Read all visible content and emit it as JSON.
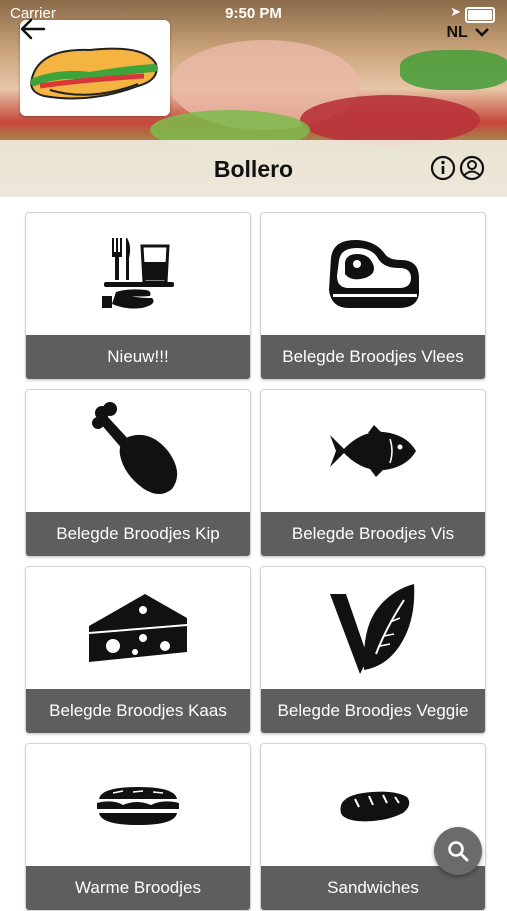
{
  "status_bar": {
    "carrier": "Carrier",
    "time": "9:50 PM"
  },
  "header": {
    "language": "NL",
    "title": "Bollero",
    "logo_icon": "sandwich-logo-icon",
    "back_icon": "arrow-left-icon",
    "info_icon": "info-icon",
    "account_icon": "user-circle-icon"
  },
  "categories": [
    {
      "label": "Nieuw!!!",
      "icon": "tray-cutlery-icon"
    },
    {
      "label": "Belegde Broodjes Vlees",
      "icon": "steak-icon"
    },
    {
      "label": "Belegde Broodjes Kip",
      "icon": "chicken-leg-icon"
    },
    {
      "label": "Belegde Broodjes Vis",
      "icon": "fish-icon"
    },
    {
      "label": "Belegde Broodjes Kaas",
      "icon": "cheese-icon"
    },
    {
      "label": "Belegde Broodjes Veggie",
      "icon": "veggie-leaf-icon"
    },
    {
      "label": "Warme Broodjes",
      "icon": "hot-sandwich-icon"
    },
    {
      "label": "Sandwiches",
      "icon": "bread-icon"
    }
  ],
  "search_fab_icon": "search-icon",
  "colors": {
    "label_bg": "#5e5e5e",
    "label_text": "#ffffff",
    "icon": "#111111"
  }
}
